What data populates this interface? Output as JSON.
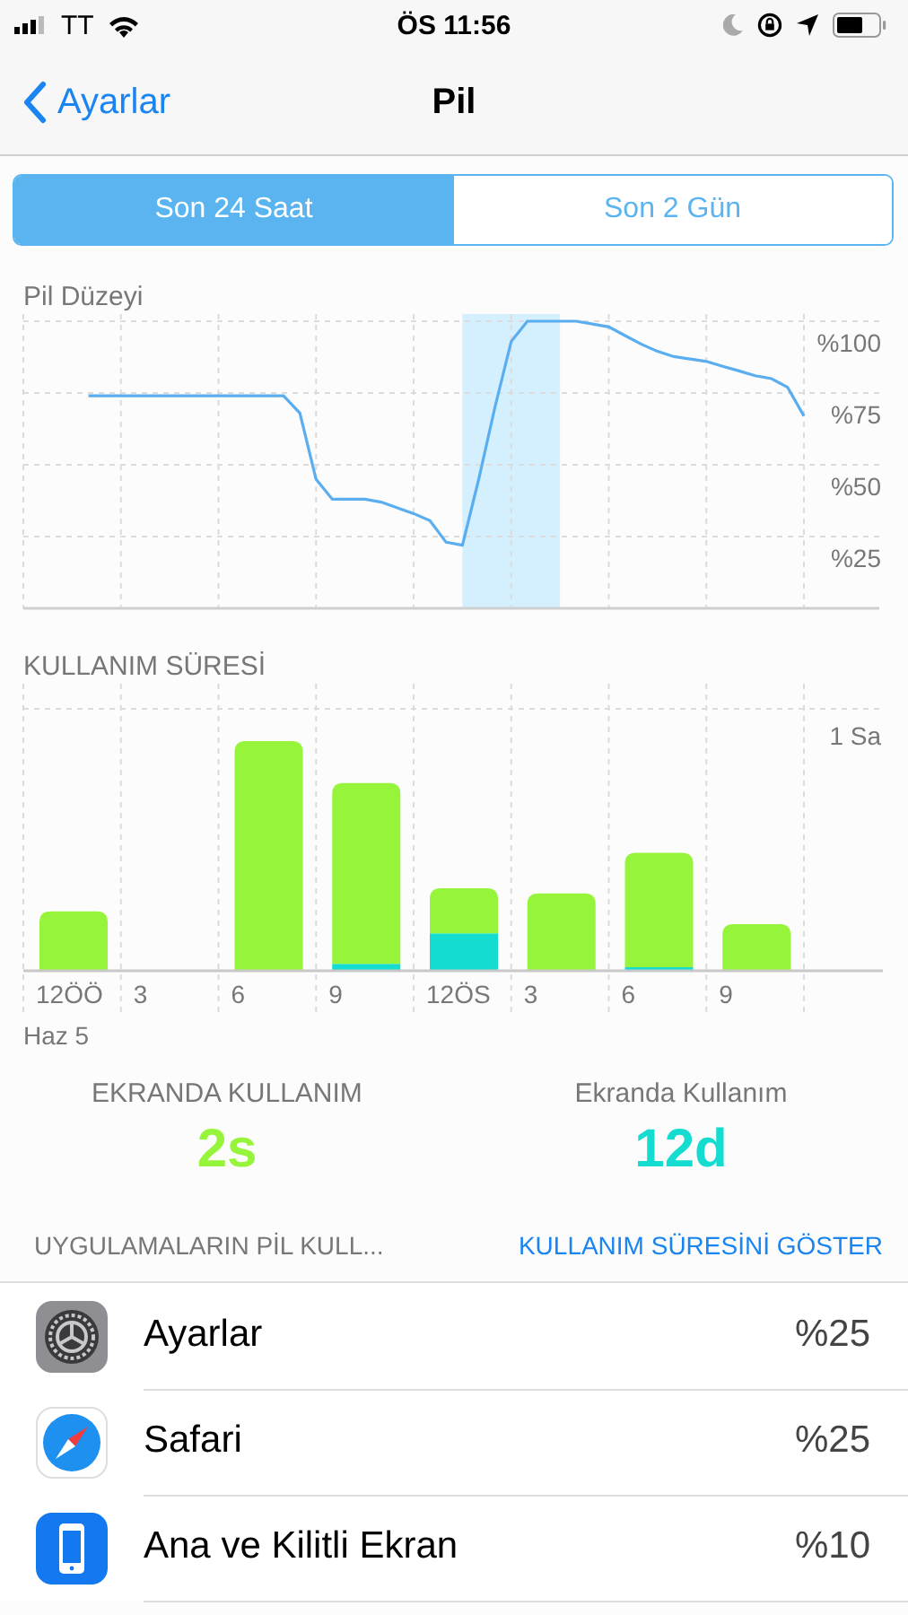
{
  "status_bar": {
    "carrier": "TT",
    "time": "ÖS 11:56"
  },
  "nav": {
    "back": "Ayarlar",
    "title": "Pil"
  },
  "segments": [
    {
      "label": "Son 24 Saat",
      "selected": true
    },
    {
      "label": "Son 2 Gün",
      "selected": false
    }
  ],
  "battery_chart": {
    "chart_data": {
      "type": "line",
      "title": "Pil Düzeyi",
      "ylim": [
        0,
        100
      ],
      "yticks": [
        {
          "value": 100,
          "label": "%100"
        },
        {
          "value": 75,
          "label": "%75"
        },
        {
          "value": 50,
          "label": "%50"
        },
        {
          "value": 25,
          "label": "%25"
        }
      ],
      "categories": [
        null,
        null,
        null,
        null,
        null,
        null,
        null,
        null,
        null,
        null,
        null,
        null,
        null,
        null,
        null,
        null,
        null,
        null,
        null,
        null,
        null,
        null,
        null,
        null,
        null,
        null,
        null,
        null,
        null,
        null,
        null,
        null,
        null,
        null,
        null,
        null,
        null,
        null,
        null,
        null,
        null,
        null,
        null,
        null,
        null,
        null,
        null,
        null,
        null
      ],
      "series": [
        {
          "color": "#5aaef0",
          "values": [
            null,
            null,
            null,
            null,
            74,
            74,
            74,
            74,
            74,
            74,
            74,
            74,
            74,
            74,
            74,
            74,
            74,
            68,
            45,
            38,
            38,
            38,
            37,
            35,
            33,
            30.5,
            23,
            22,
            45,
            70,
            93,
            100,
            100,
            100,
            100,
            99,
            98,
            95,
            92,
            89.5,
            87.7,
            86.8,
            86,
            84.3,
            82.7,
            81,
            80,
            77,
            67
          ]
        }
      ],
      "grid": true
    }
  },
  "usage_chart": {
    "title": "KULLANIM SÜRESİ",
    "scale_label": "1 Sa",
    "x_labels": [
      "12ÖÖ",
      "3",
      "6",
      "9",
      "12ÖS",
      "3",
      "6",
      "9"
    ],
    "date": "Haz 5"
  },
  "stats": [
    {
      "label": "EKRANDA KULLANIM",
      "value": "2s",
      "color": "#96f53a"
    },
    {
      "label": "Ekranda Kullanım",
      "value": "12d",
      "color": "#14dcd0"
    }
  ],
  "apps_header": {
    "title": "UYGULAMALARIN PİL KULL...",
    "action": "KULLANIM SÜRESİNİ GÖSTER"
  },
  "apps": [
    {
      "kind": "settings",
      "name": "Ayarlar",
      "percent": "%25"
    },
    {
      "kind": "safari",
      "name": "Safari",
      "percent": "%25"
    },
    {
      "kind": "home",
      "name": "Ana ve Kilitli Ekran",
      "percent": "%10"
    }
  ]
}
